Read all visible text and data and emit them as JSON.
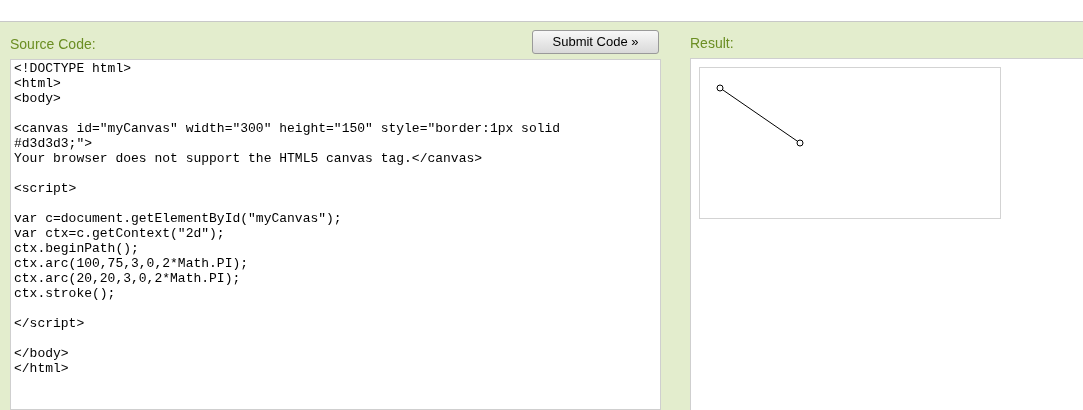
{
  "source": {
    "label": "Source Code:",
    "code": "<!DOCTYPE html>\n<html>\n<body>\n\n<canvas id=\"myCanvas\" width=\"300\" height=\"150\" style=\"border:1px solid\n#d3d3d3;\">\nYour browser does not support the HTML5 canvas tag.</canvas>\n\n<script>\n\nvar c=document.getElementById(\"myCanvas\");\nvar ctx=c.getContext(\"2d\");\nctx.beginPath();\nctx.arc(100,75,3,0,2*Math.PI);\nctx.arc(20,20,3,0,2*Math.PI);\nctx.stroke();\n\n</script>\n\n</body>\n</html>"
  },
  "submit_button": "Submit Code »",
  "result": {
    "label": "Result:"
  }
}
